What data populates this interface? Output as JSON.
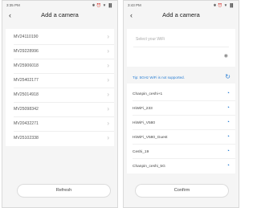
{
  "left_screen": {
    "status_time": "3:35 PM",
    "status_icons": "✱ ⏰ ▼ ▐▌",
    "title": "Add a camera",
    "devices": [
      "MV24110190",
      "MV29228996",
      "MV25906018",
      "MV25402177",
      "MV25014918",
      "MV25098342",
      "MV20432271",
      "MV25102338"
    ],
    "footer_button": "Refresh"
  },
  "right_screen": {
    "status_time": "3:43 PM",
    "status_icons": "✱ ⏰ ▼ ▐▌",
    "title": "Add a camera",
    "wifi_placeholder": "Select your WiFi",
    "tip": "Tip: 5GHz WiFi is not supported.",
    "networks": [
      "Chanpin_ceshi+1",
      "HiWiFi_233",
      "HiWiFi_V580",
      "HiWiFi_V580_Guest",
      "Ceshi_19",
      "Chanpin_ceshi_5G"
    ],
    "footer_button": "Confirm"
  },
  "icons": {
    "back": "chevron-left-icon",
    "chevron": "chevron-right-icon",
    "wifi": "wifi-icon",
    "eye": "eye-icon",
    "refresh": "refresh-icon"
  },
  "colors": {
    "accent": "#2a7fd4",
    "background": "#f5f5f5"
  }
}
